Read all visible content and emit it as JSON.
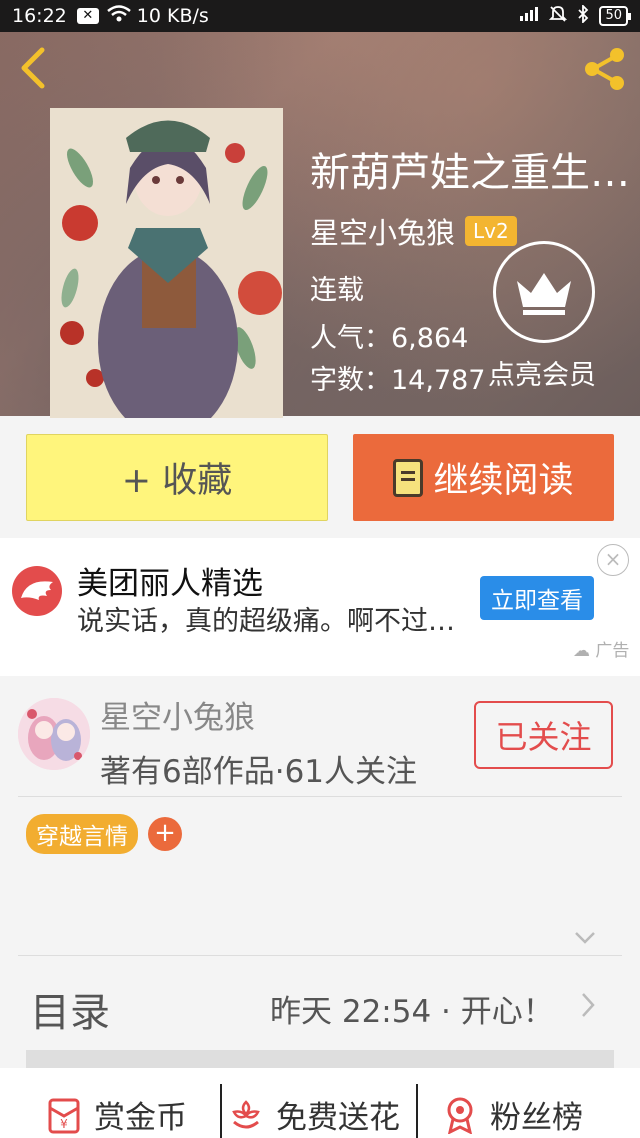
{
  "status_bar": {
    "time": "16:22",
    "network_speed": "10 KB/s",
    "battery": "50"
  },
  "book": {
    "title": "新葫芦娃之重生…",
    "author": "星空小兔狼",
    "level": "Lv2",
    "status": "连载",
    "popularity": "人气：6,864",
    "wordcount": "字数：14,787",
    "vip_label": "点亮会员"
  },
  "actions": {
    "favorite": "+ 收藏",
    "continue_reading": "继续阅读"
  },
  "ad": {
    "title": "美团丽人精选",
    "description": "说实话，真的超级痛。啊不过…",
    "cta": "立即查看",
    "close": "×",
    "tag": "广告"
  },
  "author_block": {
    "name": "星空小兔狼",
    "meta": "著有6部作品·61人关注",
    "follow_button": "已关注"
  },
  "tags": [
    "穿越言情"
  ],
  "tag_add": "+",
  "toc": {
    "label": "目录",
    "latest": "昨天 22:54 · 开心！"
  },
  "bottom_actions": {
    "reward": "赏金币",
    "flowers": "免费送花",
    "fans": "粉丝榜"
  },
  "colors": {
    "accent_orange": "#eb6a3c",
    "favorite_yellow": "#fff57c",
    "follow_red": "#e34c4c",
    "level_badge": "#f3b531",
    "ad_button_blue": "#2a8de8"
  }
}
